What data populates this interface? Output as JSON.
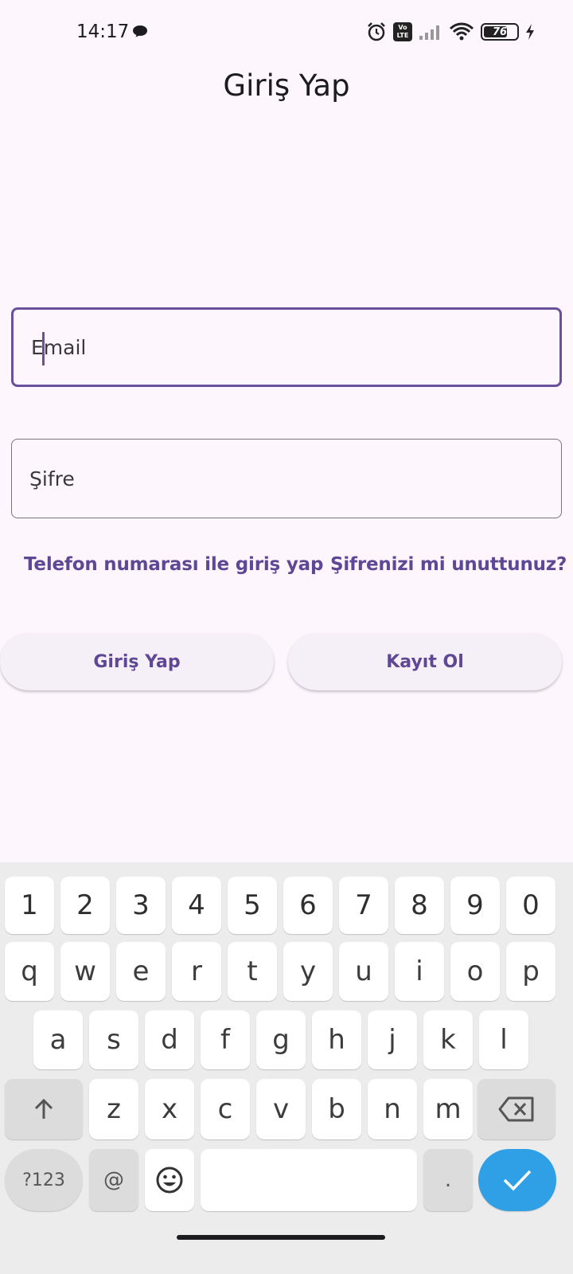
{
  "status_bar": {
    "time": "14:17",
    "chat_icon": "chat-bubble-icon",
    "alarm_icon": "alarm-icon",
    "volte_top": "Vo",
    "volte_bottom": "LTE",
    "signal_icon": "signal-icon",
    "wifi_icon": "wifi-icon",
    "battery_level": "76",
    "charging_icon": "bolt-icon"
  },
  "screen": {
    "title": "Giriş Yap"
  },
  "form": {
    "email": {
      "placeholder": "Email",
      "value": ""
    },
    "password": {
      "placeholder": "Şifre",
      "value": ""
    }
  },
  "links": {
    "phone_login": "Telefon numarası ile giriş yap",
    "forgot_password": "Şifrenizi mi unuttunuz?"
  },
  "buttons": {
    "login": "Giriş Yap",
    "register": "Kayıt Ol"
  },
  "keyboard": {
    "digits": [
      "1",
      "2",
      "3",
      "4",
      "5",
      "6",
      "7",
      "8",
      "9",
      "0"
    ],
    "row1": [
      "q",
      "w",
      "e",
      "r",
      "t",
      "y",
      "u",
      "i",
      "o",
      "p"
    ],
    "row2": [
      "a",
      "s",
      "d",
      "f",
      "g",
      "h",
      "j",
      "k",
      "l"
    ],
    "row3": [
      "z",
      "x",
      "c",
      "v",
      "b",
      "n",
      "m"
    ],
    "symbols_key": "?123",
    "at_key": "@",
    "period_key": ".",
    "shift_icon": "shift-arrow-icon",
    "backspace_icon": "backspace-icon",
    "emoji_icon": "emoji-icon",
    "enter_icon": "checkmark-icon",
    "enter_color": "#2f9fe6"
  },
  "theme": {
    "accent": "#5e4896",
    "background": "#fdf6fd"
  }
}
